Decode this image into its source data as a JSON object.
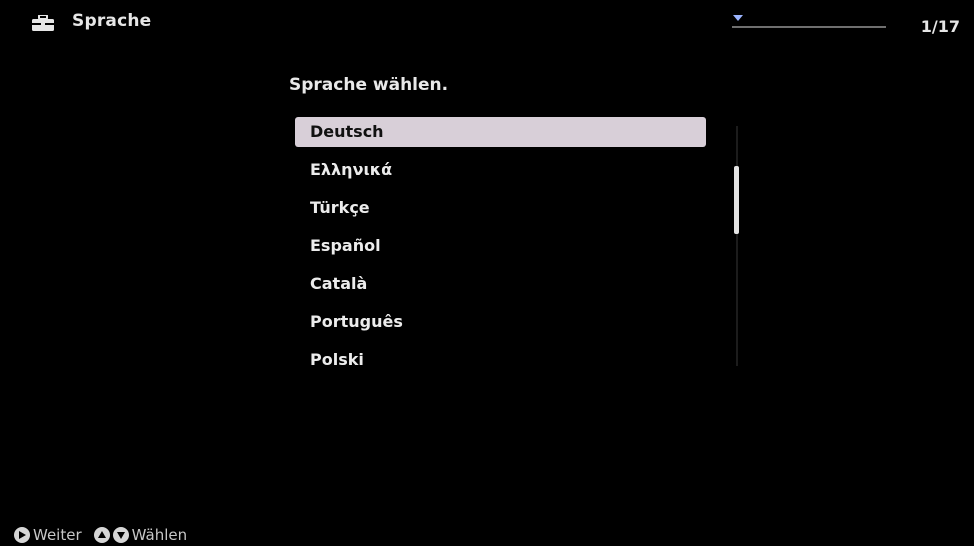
{
  "header": {
    "icon": "toolbox-icon",
    "title": "Sprache",
    "page_counter": "1/17",
    "progress_fraction": 0.0
  },
  "main": {
    "prompt": "Sprache wählen.",
    "selected_index": 0,
    "languages": [
      {
        "label": "Deutsch"
      },
      {
        "label": "Ελληνικά"
      },
      {
        "label": "Türkçe"
      },
      {
        "label": "Español"
      },
      {
        "label": "Català"
      },
      {
        "label": "Português"
      },
      {
        "label": "Polski"
      }
    ]
  },
  "footer": {
    "weiter_icon": "right-arrow-button-icon",
    "weiter_label": "Weiter",
    "waehlen_icons": [
      "up-arrow-button-icon",
      "down-arrow-button-icon"
    ],
    "waehlen_label": "Wählen"
  },
  "colors": {
    "background": "#000000",
    "text": "#e8e8e8",
    "selection": "#d8cfd8",
    "marker": "#9bb4ff"
  }
}
